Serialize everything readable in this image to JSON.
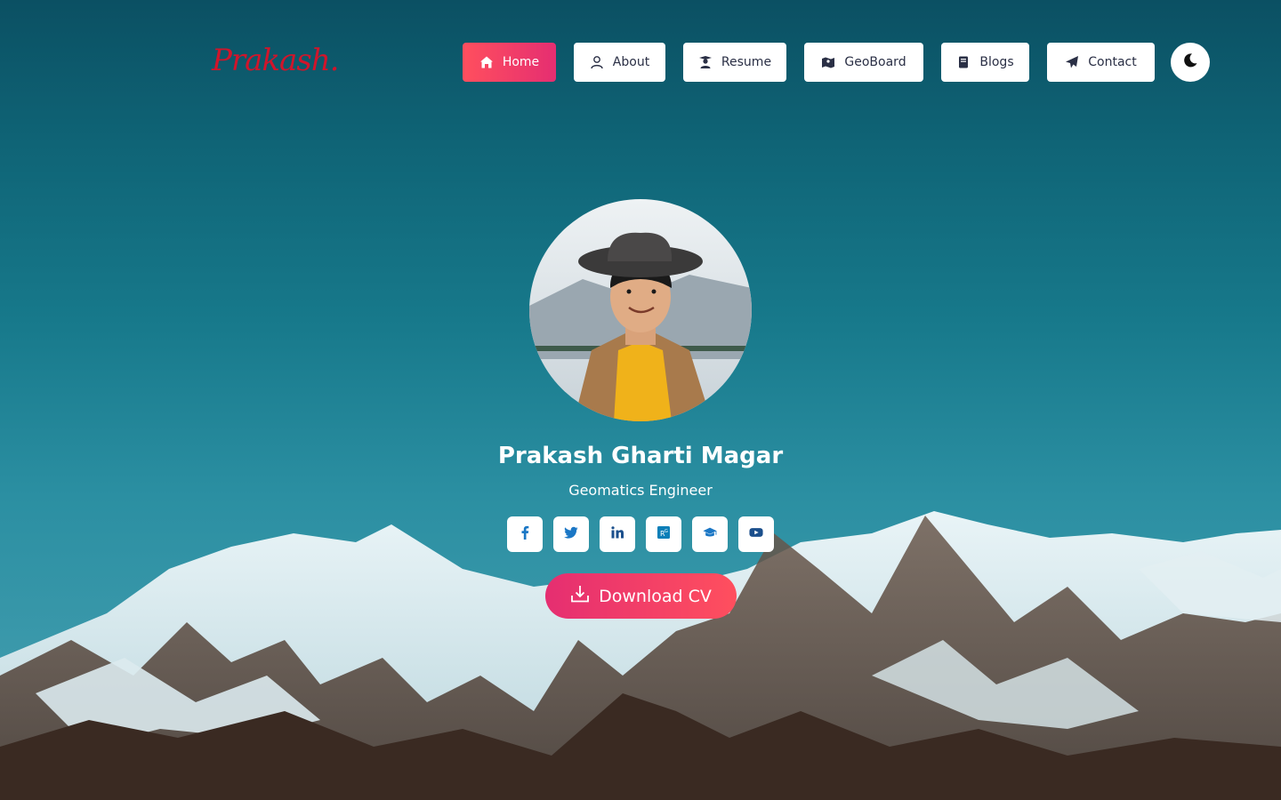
{
  "brand": {
    "logo_text": "Prakash."
  },
  "nav": {
    "items": [
      {
        "label": "Home",
        "icon": "home-icon",
        "active": true
      },
      {
        "label": "About",
        "icon": "user-icon",
        "active": false
      },
      {
        "label": "Resume",
        "icon": "graduate-icon",
        "active": false
      },
      {
        "label": "GeoBoard",
        "icon": "map-icon",
        "active": false
      },
      {
        "label": "Blogs",
        "icon": "book-icon",
        "active": false
      },
      {
        "label": "Contact",
        "icon": "paper-plane-icon",
        "active": false
      }
    ],
    "theme_toggle_icon": "moon-icon"
  },
  "hero": {
    "name": "Prakash Gharti Magar",
    "role": "Geomatics Engineer",
    "socials": [
      {
        "network": "facebook",
        "icon": "facebook-icon"
      },
      {
        "network": "twitter",
        "icon": "twitter-icon"
      },
      {
        "network": "linkedin",
        "icon": "linkedin-icon"
      },
      {
        "network": "researchgate",
        "icon": "researchgate-icon"
      },
      {
        "network": "google-scholar",
        "icon": "graduation-cap-icon"
      },
      {
        "network": "youtube",
        "icon": "youtube-icon"
      }
    ],
    "cv_button": {
      "label": "Download CV",
      "icon": "download-icon"
    }
  },
  "colors": {
    "accent": "#e52e71",
    "accent_light": "#ff4f5e",
    "logo": "#d0152b",
    "nav_text": "#2a2f45",
    "social_icon": "#1b77c5"
  }
}
